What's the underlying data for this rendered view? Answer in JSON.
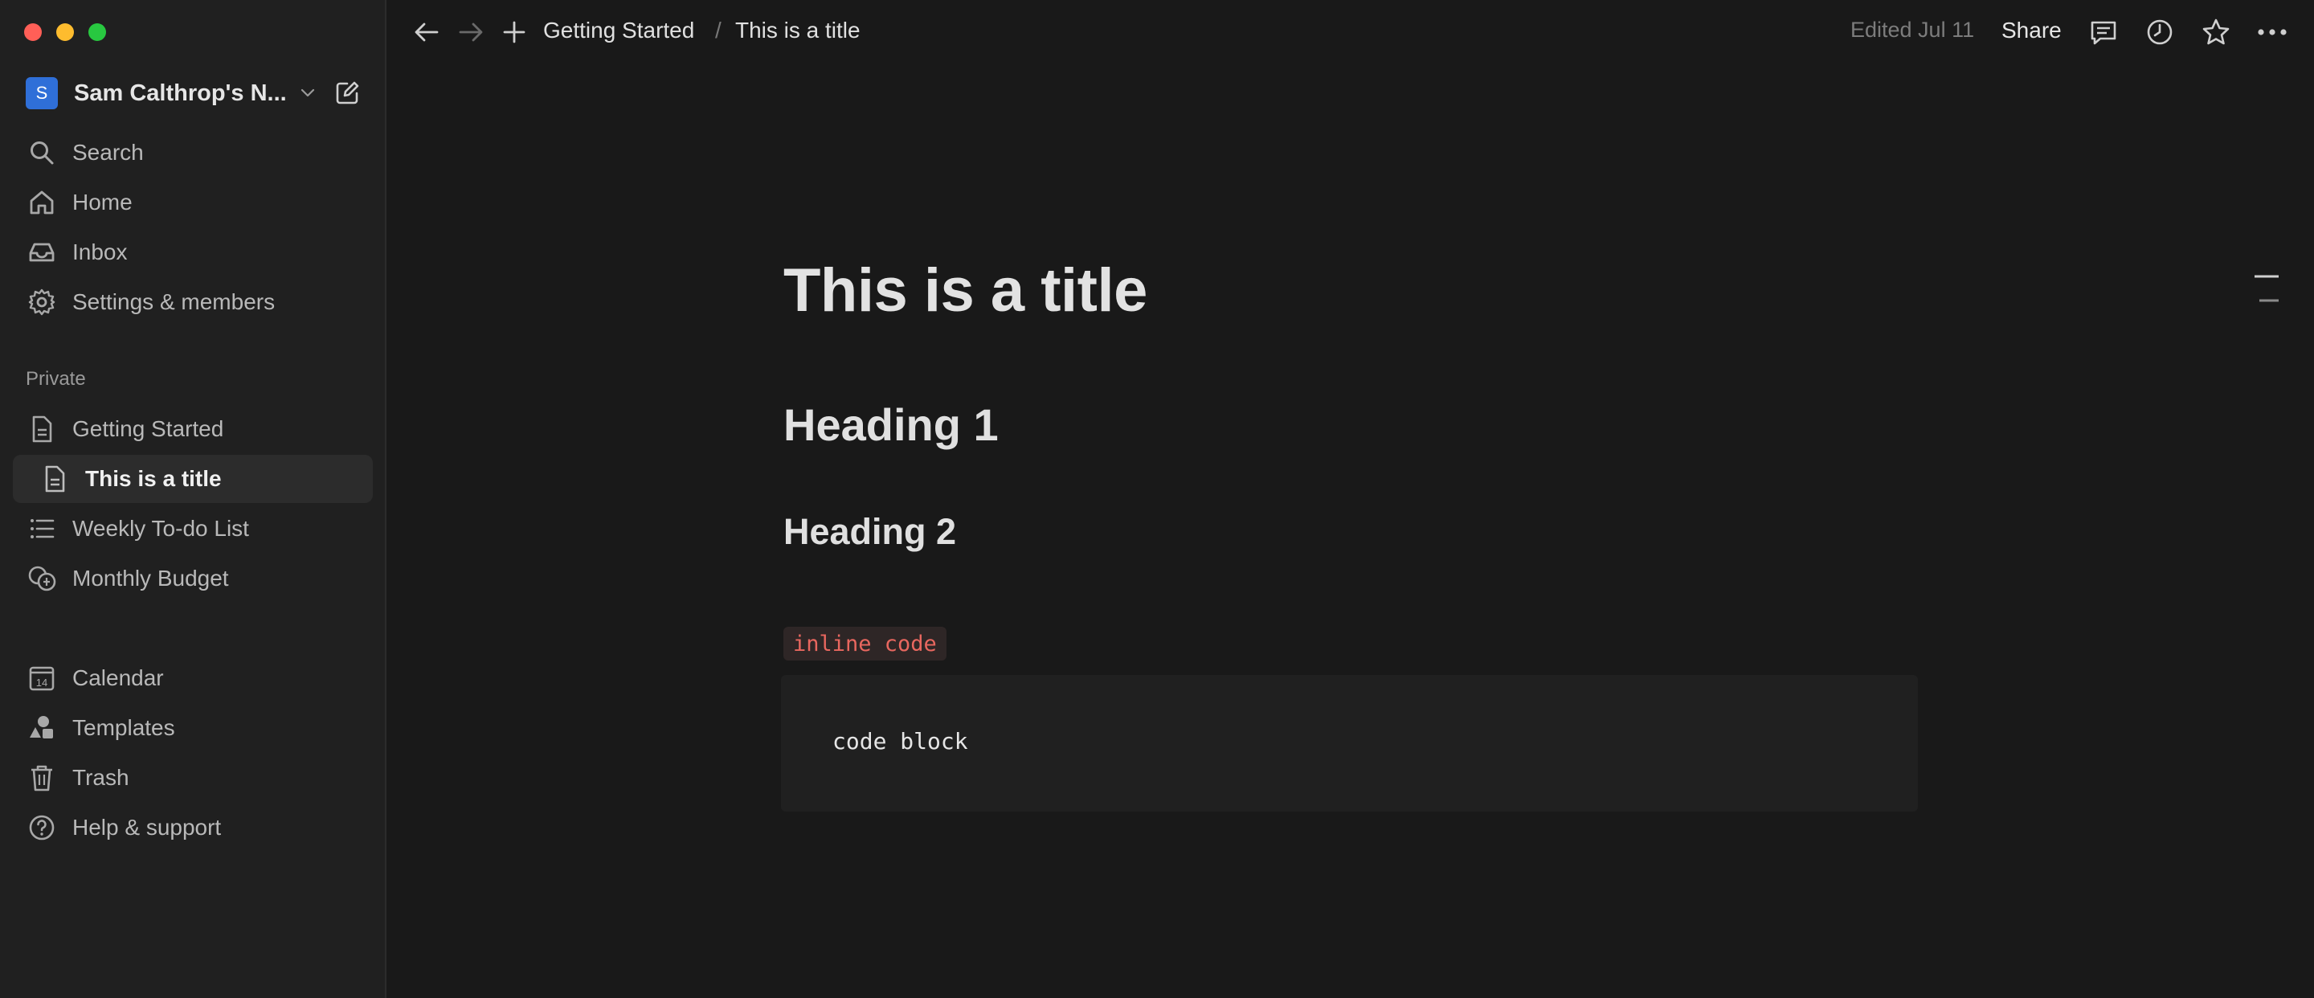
{
  "window": {
    "controls": [
      "close",
      "minimize",
      "zoom"
    ]
  },
  "sidebar": {
    "workspace": {
      "initial": "S",
      "name": "Sam Calthrop's N..."
    },
    "top_items": [
      {
        "label": "Search",
        "icon": "search-icon"
      },
      {
        "label": "Home",
        "icon": "home-icon"
      },
      {
        "label": "Inbox",
        "icon": "inbox-icon"
      },
      {
        "label": "Settings & members",
        "icon": "gear-icon"
      }
    ],
    "section_label": "Private",
    "pages": [
      {
        "label": "Getting Started",
        "icon": "page-icon"
      },
      {
        "label": "This is a title",
        "icon": "page-icon",
        "active": true
      },
      {
        "label": "Weekly To-do List",
        "icon": "list-icon"
      },
      {
        "label": "Monthly Budget",
        "icon": "coins-icon"
      }
    ],
    "bottom_items": [
      {
        "label": "Calendar",
        "icon": "calendar-icon",
        "day": "14"
      },
      {
        "label": "Templates",
        "icon": "shapes-icon"
      },
      {
        "label": "Trash",
        "icon": "trash-icon"
      },
      {
        "label": "Help & support",
        "icon": "help-icon"
      }
    ]
  },
  "topbar": {
    "breadcrumb": [
      "Getting Started",
      "This is a title"
    ],
    "separator": "/",
    "edited": "Edited Jul 11",
    "share_label": "Share"
  },
  "content": {
    "title": "This is a title",
    "heading1": "Heading 1",
    "heading2": "Heading 2",
    "inline_code": "inline code",
    "code_block": "code block"
  },
  "colors": {
    "background": "#191919",
    "sidebar": "#202020",
    "accent": "#2f6fd8",
    "inline_code": "#e8675f"
  }
}
